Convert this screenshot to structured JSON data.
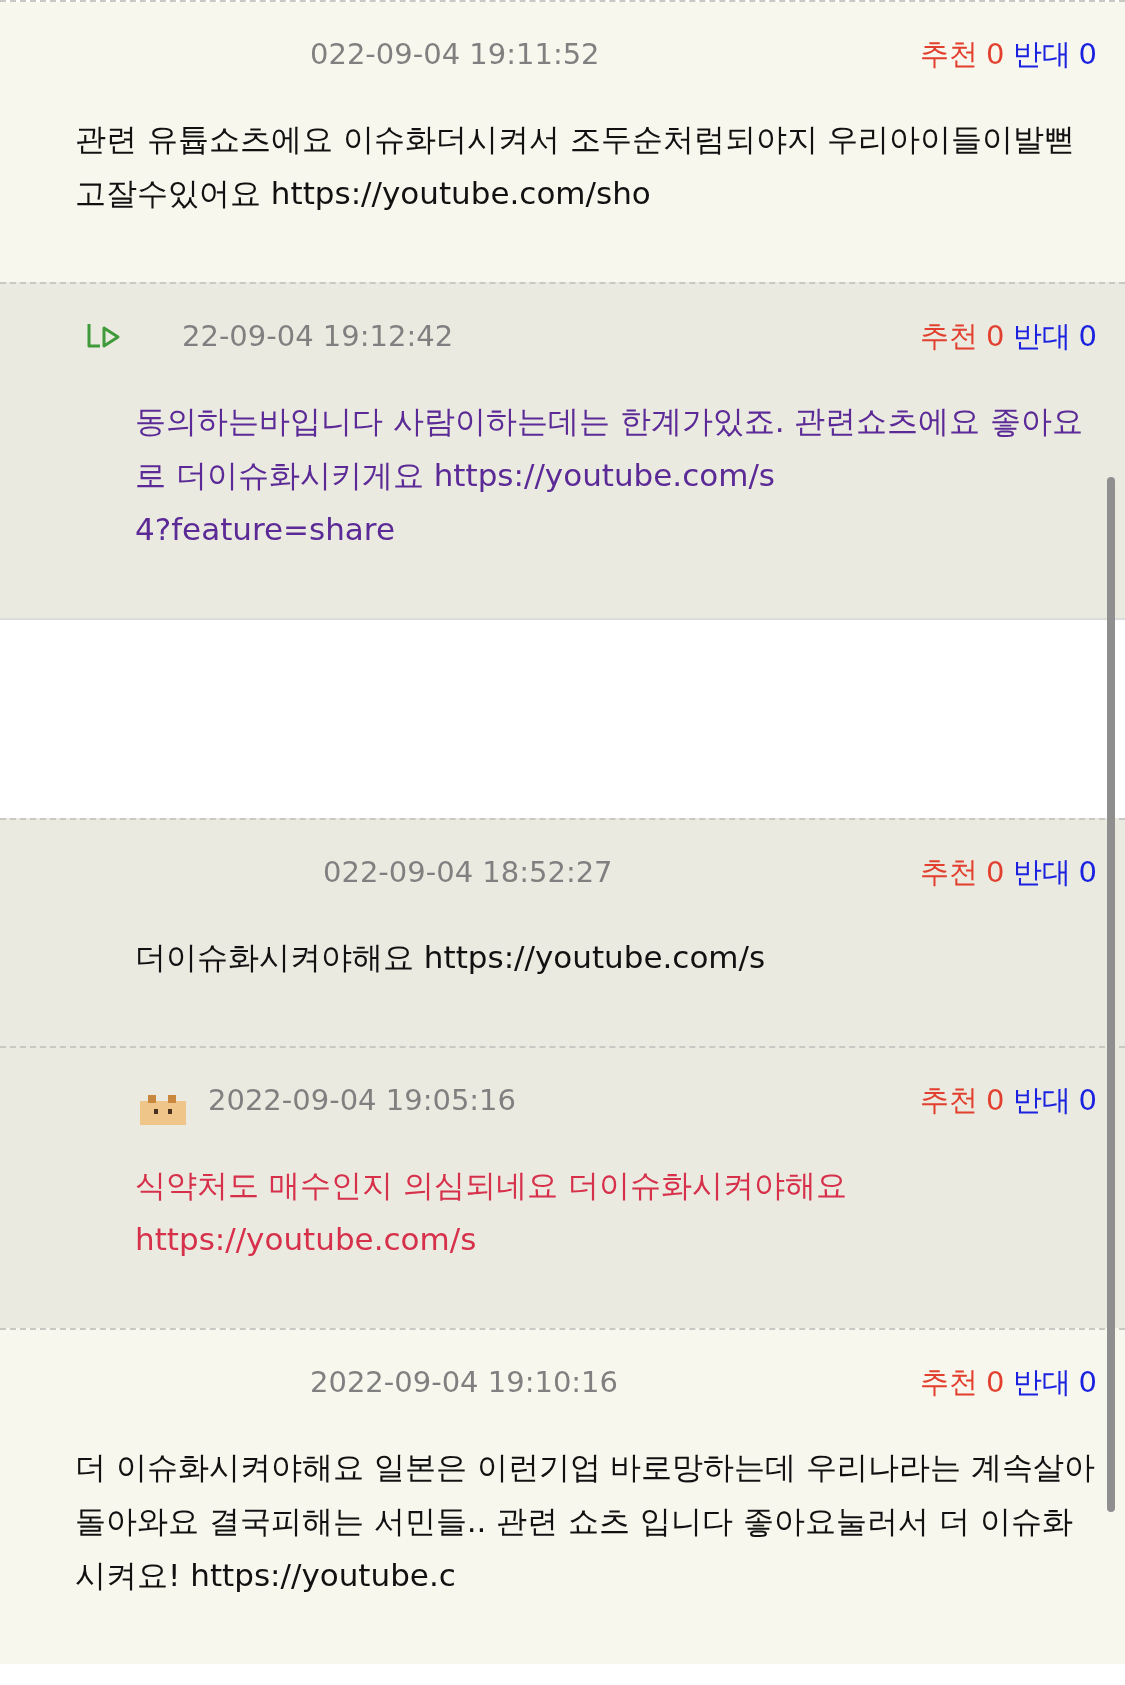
{
  "comments": [
    {
      "kind": "comment",
      "shaded": false,
      "indented": false,
      "reply_icon": false,
      "avatar": false,
      "date": "022-09-04 19:11:52",
      "up_label": "추천",
      "up": "0",
      "down_label": "반대",
      "down": "0",
      "color": "#111111",
      "text": "관련 유튭쇼츠에요 이슈화더시켜서 조두순처럼되야지 우리아이들이발뻗고잘수있어요 https://youtube.com/sho"
    },
    {
      "kind": "comment",
      "shaded": true,
      "indented": true,
      "reply_icon": true,
      "avatar": false,
      "date": "22-09-04 19:12:42",
      "up_label": "추천",
      "up": "0",
      "down_label": "반대",
      "down": "0",
      "color": "#5b2a96",
      "text": "동의하는바입니다 사람이하는데는 한계가있죠. 관련쇼츠에요 좋아요로 더이슈화시키게요 https://youtube.com/s",
      "text_2": "4?feature=share"
    },
    {
      "kind": "removed"
    },
    {
      "kind": "comment",
      "shaded": true,
      "indented": true,
      "reply_icon": false,
      "avatar": false,
      "date": "022-09-04 18:52:27",
      "up_label": "추천",
      "up": "0",
      "down_label": "반대",
      "down": "0",
      "color": "#111111",
      "text": "더이슈화시켜야해요 https://youtube.com/s"
    },
    {
      "kind": "comment",
      "shaded": true,
      "indented": true,
      "reply_icon": false,
      "avatar": true,
      "date": "2022-09-04 19:05:16",
      "up_label": "추천",
      "up": "0",
      "down_label": "반대",
      "down": "0",
      "color": "#d6304a",
      "text": "식약처도 매수인지 의심되네요 더이슈화시켜야해요 https://youtube.com/s"
    },
    {
      "kind": "comment",
      "shaded": false,
      "indented": false,
      "reply_icon": false,
      "avatar": false,
      "date": "2022-09-04 19:10:16",
      "up_label": "추천",
      "up": "0",
      "down_label": "반대",
      "down": "0",
      "color": "#111111",
      "text": "더 이슈화시켜야해요 일본은 이런기업 바로망하는데 우리나라는 계속살아돌아와요 결국피해는 서민들.. 관련 쇼츠 입니다 좋아요눌러서 더 이슈화시켜요! https://youtube.c"
    }
  ]
}
